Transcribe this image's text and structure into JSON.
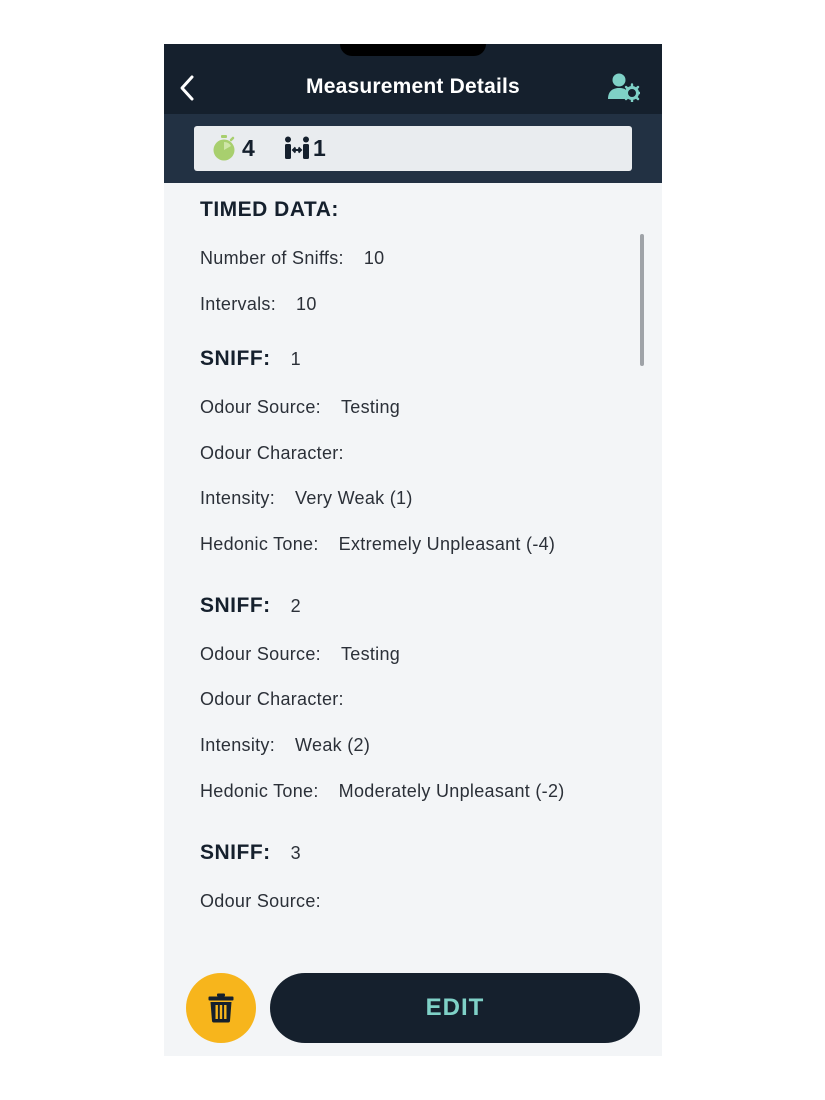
{
  "header": {
    "title": "Measurement Details"
  },
  "summary": {
    "timer_count": "4",
    "people_count": "1"
  },
  "timed_data": {
    "title": "TIMED DATA:",
    "sniffs_label": "Number of Sniffs:",
    "sniffs_value": "10",
    "intervals_label": "Intervals:",
    "intervals_value": "10"
  },
  "labels": {
    "sniff": "SNIFF:",
    "odour_source": "Odour Source:",
    "odour_character": "Odour Character:",
    "intensity": "Intensity:",
    "hedonic_tone": "Hedonic Tone:"
  },
  "sniffs": [
    {
      "number": "1",
      "odour_source": "Testing",
      "odour_character": "",
      "intensity": "Very Weak (1)",
      "hedonic_tone": "Extremely Unpleasant (-4)"
    },
    {
      "number": "2",
      "odour_source": "Testing",
      "odour_character": "",
      "intensity": "Weak (2)",
      "hedonic_tone": "Moderately Unpleasant (-2)"
    },
    {
      "number": "3",
      "odour_source": ""
    }
  ],
  "actions": {
    "edit_label": "EDIT"
  },
  "colors": {
    "header_bg": "#15202d",
    "accent_teal": "#7fd1c7",
    "delete_yellow": "#f7b51c",
    "timer_green": "#a8cf6e"
  },
  "icons": {
    "back": "chevron-left-icon",
    "user_settings": "user-gear-icon",
    "timer": "stopwatch-icon",
    "people": "people-distance-icon",
    "delete": "trash-icon"
  }
}
